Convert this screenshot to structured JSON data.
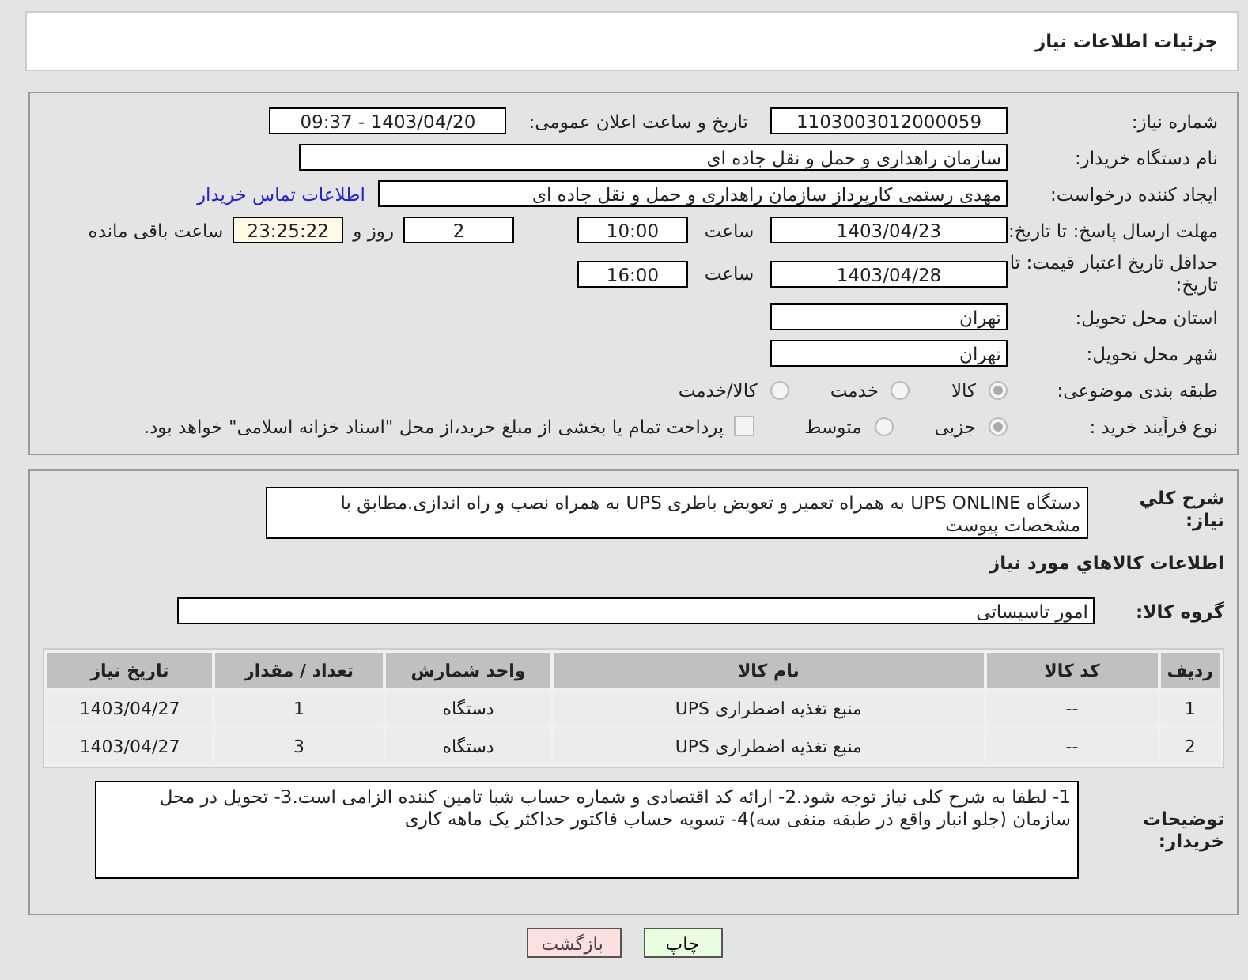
{
  "header": {
    "title": "جزئیات اطلاعات نیاز"
  },
  "need_number": {
    "label": "شماره نیاز:",
    "value": "1103003012000059"
  },
  "announce": {
    "label": "تاریخ و ساعت اعلان عمومی:",
    "value": "1403/04/20 - 09:37"
  },
  "buyer_org": {
    "label": "نام دستگاه خریدار:",
    "value": "سازمان راهداری و حمل و نقل جاده ای"
  },
  "requester": {
    "label": "ایجاد کننده درخواست:",
    "value": "مهدی رستمی کارپرداز سازمان راهداری و حمل و نقل جاده ای",
    "link": "اطلاعات تماس خریدار"
  },
  "reply_deadline": {
    "label": "مهلت ارسال پاسخ: تا تاریخ:",
    "date": "1403/04/23",
    "time_label": "ساعت",
    "time": "10:00",
    "days": "2",
    "days_label": "روز و",
    "remaining": "23:25:22",
    "remaining_label": "ساعت باقی مانده"
  },
  "validity": {
    "label": "حداقل تاریخ اعتبار قیمت: تا تاریخ:",
    "date": "1403/04/28",
    "time_label": "ساعت",
    "time": "16:00"
  },
  "province": {
    "label": "استان محل تحویل:",
    "value": "تهران"
  },
  "city": {
    "label": "شهر محل تحویل:",
    "value": "تهران"
  },
  "category": {
    "label": "طبقه بندی موضوعی:",
    "options": [
      {
        "label": "کالا",
        "selected": true
      },
      {
        "label": "خدمت",
        "selected": false
      },
      {
        "label": "کالا/خدمت",
        "selected": false
      }
    ]
  },
  "process": {
    "label": "نوع فرآیند خرید :",
    "options": [
      {
        "label": "جزیی",
        "selected": true
      },
      {
        "label": "متوسط",
        "selected": false
      }
    ],
    "payment": {
      "label": "پرداخت تمام یا بخشی از مبلغ خرید،از محل \"اسناد خزانه اسلامی\" خواهد بود.",
      "checked": false
    }
  },
  "description": {
    "label": "شرح کلي نياز:",
    "value": "دستگاه UPS ONLINE به همراه تعمیر و تعویض باطری UPS به همراه نصب و راه اندازی.مطابق با مشخصات پیوست"
  },
  "goods_title": "اطلاعات کالاهاي مورد نياز",
  "goods_group": {
    "label": "گروه کالا:",
    "value": "امور تاسیساتی"
  },
  "table": {
    "columns": [
      "ردیف",
      "کد کالا",
      "نام کالا",
      "واحد شمارش",
      "تعداد / مقدار",
      "تاریخ نیاز"
    ],
    "rows": [
      [
        "1",
        "--",
        "منبع تغذیه اضطراری UPS",
        "دستگاه",
        "1",
        "1403/04/27"
      ],
      [
        "2",
        "--",
        "منبع تغذیه اضطراری UPS",
        "دستگاه",
        "3",
        "1403/04/27"
      ]
    ]
  },
  "buyer_notes": {
    "label": "توضیحات خریدار:",
    "value": "1- لطفا به شرح کلی نیاز توجه شود.2- ارائه کد اقتصادی و شماره حساب شبا تامین کننده الزامی است.3- تحویل در محل سازمان (جلو انبار واقع در طبقه منفی سه)4- تسویه حساب فاکتور حداکثر یک ماهه کاری"
  },
  "buttons": [
    {
      "label": "چاپ",
      "kind": "print"
    },
    {
      "label": "بازگشت",
      "kind": "back"
    }
  ]
}
